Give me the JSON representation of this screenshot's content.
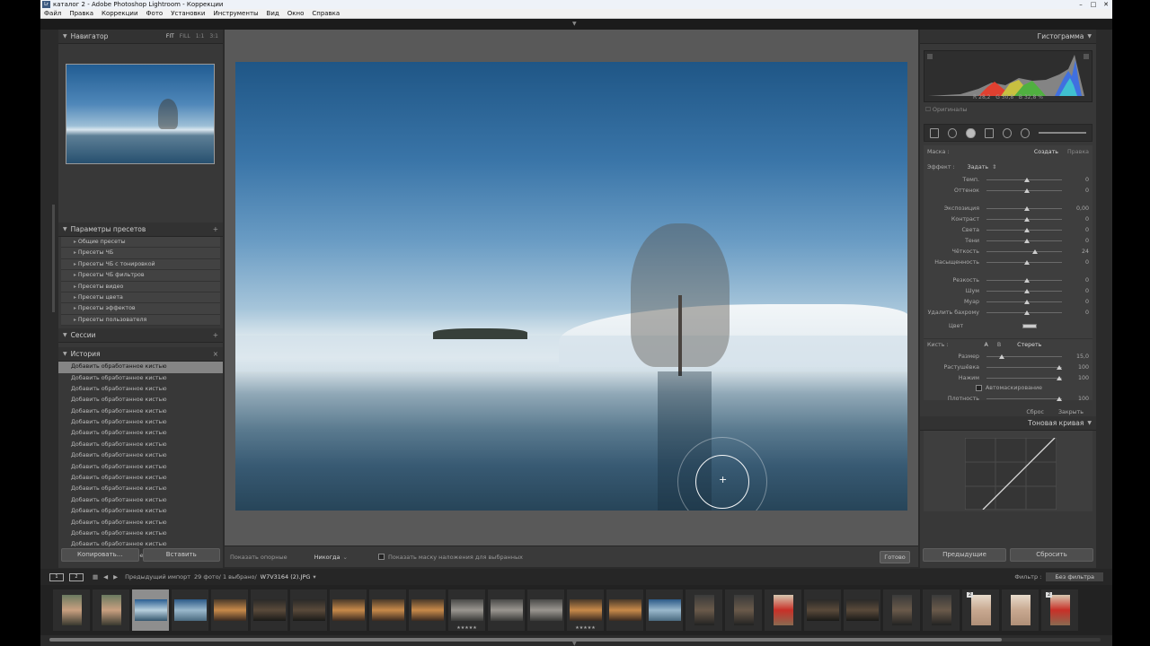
{
  "window": {
    "title": "каталог 2 - Adobe Photoshop Lightroom - Коррекции",
    "app_icon": "Lr",
    "controls": [
      "–",
      "□",
      "✕"
    ]
  },
  "menu": [
    "Файл",
    "Правка",
    "Коррекции",
    "Фото",
    "Установки",
    "Инструменты",
    "Вид",
    "Окно",
    "Справка"
  ],
  "navigator": {
    "title": "Навигатор",
    "options": [
      "FIT",
      "FILL",
      "1:1",
      "3:1"
    ]
  },
  "presets": {
    "title": "Параметры пресетов",
    "items": [
      "Общие пресеты",
      "Пресеты ЧБ",
      "Пресеты ЧБ с тонировкой",
      "Пресеты ЧБ фильтров",
      "Пресеты видео",
      "Пресеты цвета",
      "Пресеты эффектов",
      "Пресеты пользователя"
    ]
  },
  "sessions": {
    "title": "Сессии"
  },
  "history": {
    "title": "История",
    "close": "×",
    "item": "Добавить обработанное кистью",
    "count": 18
  },
  "left_buttons": {
    "copy": "Копировать...",
    "paste": "Вставить"
  },
  "toolbar": {
    "show_pins_label": "Показать опорные",
    "show_pins_value": "Никогда",
    "overlay_label": "Показать маску наложения для выбранных",
    "done": "Готово"
  },
  "histogram": {
    "title": "Гистограмма",
    "r_label": "R",
    "r": "28,2",
    "g_label": "G",
    "g": "30,8",
    "b_label": "B",
    "b": "32,8",
    "pct": "%",
    "originals": "Оригиналы"
  },
  "mask": {
    "label": "Маска :",
    "create": "Создать",
    "edit": "Правка",
    "effect_label": "Эффект :",
    "effect_value": "Задать",
    "sliders": [
      {
        "label": "Темп.",
        "value": "0"
      },
      {
        "label": "Оттенок",
        "value": "0"
      },
      {
        "label": "Экспозиция",
        "value": "0,00"
      },
      {
        "label": "Контраст",
        "value": "0"
      },
      {
        "label": "Света",
        "value": "0"
      },
      {
        "label": "Тени",
        "value": "0"
      },
      {
        "label": "Чёткость",
        "value": "24"
      },
      {
        "label": "Насыщенность",
        "value": "0"
      },
      {
        "label": "Резкость",
        "value": "0"
      },
      {
        "label": "Шум",
        "value": "0"
      },
      {
        "label": "Муар",
        "value": "0"
      },
      {
        "label": "Удалить бахрому",
        "value": "0"
      }
    ],
    "color": "Цвет",
    "brush_label": "Кисть :",
    "brush_a": "A",
    "brush_b": "B",
    "brush_erase": "Стереть",
    "brush_sliders": [
      {
        "label": "Размер",
        "value": "15,0"
      },
      {
        "label": "Растушёвка",
        "value": "100"
      },
      {
        "label": "Нажим",
        "value": "100"
      }
    ],
    "automask": "Автомаскирование",
    "density": {
      "label": "Плотность",
      "value": "100"
    },
    "reset": "Сброс",
    "close": "Закрыть"
  },
  "tone_curve": {
    "title": "Тоновая кривая"
  },
  "right_buttons": {
    "previous": "Предыдущие",
    "reset": "Сбросить"
  },
  "filmbar": {
    "monitor1": "1",
    "monitor2": "2",
    "source": "Предыдущий импорт",
    "count": "29 фото/ 1 выбрано/",
    "file": "W7V3164 (2).JPG",
    "filter_label": "Фильтр :",
    "filter_value": "Без фильтра"
  },
  "filmstrip": [
    {
      "kind": "portrait",
      "badge": "",
      "stars": ""
    },
    {
      "kind": "portrait",
      "badge": "",
      "stars": ""
    },
    {
      "kind": "land-sel",
      "badge": "",
      "stars": ""
    },
    {
      "kind": "land",
      "badge": "",
      "stars": ""
    },
    {
      "kind": "land-warm",
      "badge": "",
      "stars": ""
    },
    {
      "kind": "land-dark",
      "badge": "",
      "stars": ""
    },
    {
      "kind": "land-dark",
      "badge": "",
      "stars": ""
    },
    {
      "kind": "land-warm",
      "badge": "",
      "stars": ""
    },
    {
      "kind": "land-warm",
      "badge": "",
      "stars": ""
    },
    {
      "kind": "land-warm",
      "badge": "",
      "stars": ""
    },
    {
      "kind": "land-grey",
      "badge": "",
      "stars": "★★★★★"
    },
    {
      "kind": "land-grey",
      "badge": "",
      "stars": ""
    },
    {
      "kind": "land-grey",
      "badge": "",
      "stars": ""
    },
    {
      "kind": "land-warm",
      "badge": "",
      "stars": "★★★★★"
    },
    {
      "kind": "land-warm",
      "badge": "",
      "stars": ""
    },
    {
      "kind": "land",
      "badge": "",
      "stars": ""
    },
    {
      "kind": "portrait-dark",
      "badge": "",
      "stars": ""
    },
    {
      "kind": "portrait-dark",
      "badge": "",
      "stars": ""
    },
    {
      "kind": "portrait-red",
      "badge": "",
      "stars": ""
    },
    {
      "kind": "land-dark",
      "badge": "",
      "stars": ""
    },
    {
      "kind": "land-dark",
      "badge": "",
      "stars": ""
    },
    {
      "kind": "portrait-dark",
      "badge": "",
      "stars": ""
    },
    {
      "kind": "portrait-dark",
      "badge": "",
      "stars": ""
    },
    {
      "kind": "portrait-light",
      "badge": "2",
      "stars": ""
    },
    {
      "kind": "portrait-light",
      "badge": "",
      "stars": ""
    },
    {
      "kind": "portrait-red",
      "badge": "2",
      "stars": ""
    }
  ],
  "colors": {
    "accent": "#b5b5b5",
    "selected": "#858585",
    "panel": "#383838"
  }
}
